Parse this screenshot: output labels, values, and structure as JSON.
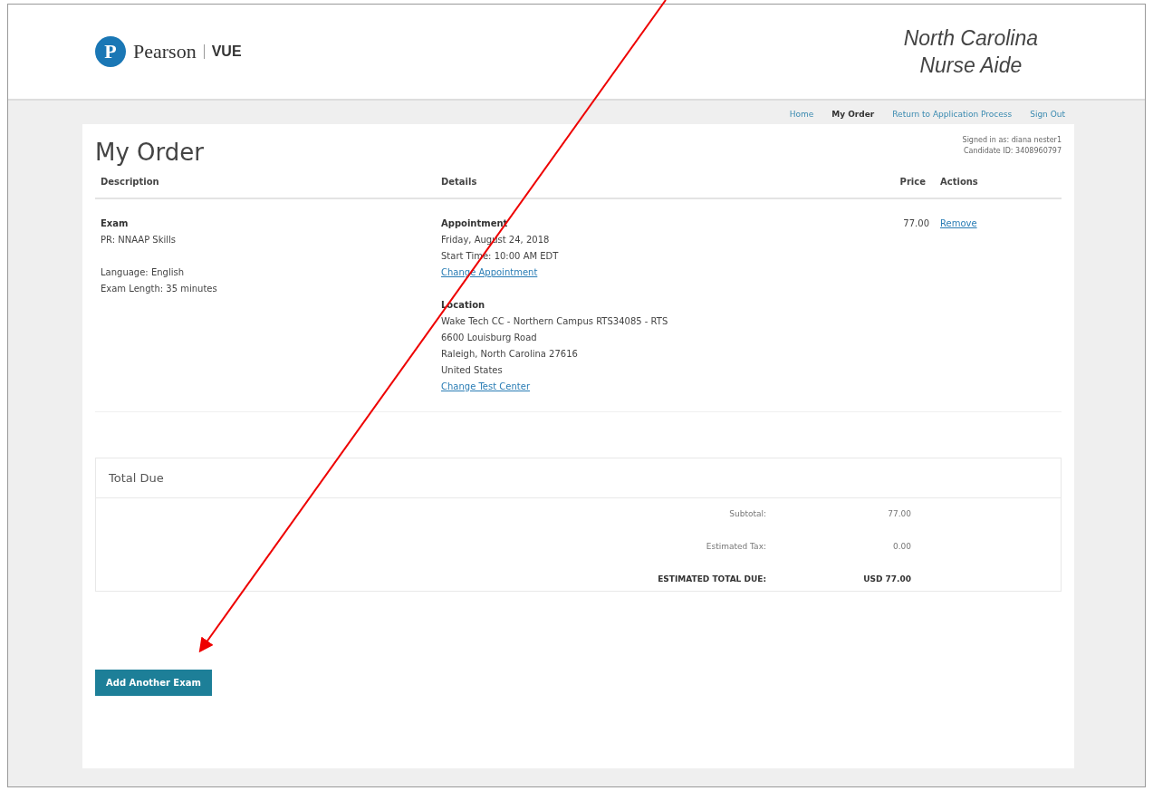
{
  "header": {
    "logo_letter": "P",
    "brand": "Pearson",
    "product": "VUE",
    "program_title": [
      "North Carolina",
      "Nurse Aide"
    ]
  },
  "nav": [
    {
      "label": "Home",
      "selected": false
    },
    {
      "label": "My Order",
      "selected": true
    },
    {
      "label": "Return to Application Process",
      "selected": false
    },
    {
      "label": "Sign Out",
      "selected": false
    }
  ],
  "page_title": "My Order",
  "account": [
    "Signed in as: diana nester1",
    "Candidate ID: 3408960797"
  ],
  "table": {
    "columns": [
      "Description",
      "Details",
      "Price",
      "Actions"
    ],
    "rows": [
      {
        "item_type": "Exam",
        "exam_name": "PR: NNAAP Skills",
        "language": "Language: English",
        "length": "Exam Length: 35 minutes",
        "details": [
          {
            "heading": "Appointment",
            "lines": [
              "Friday, August 24, 2018",
              "Start Time: 10:00 AM EDT"
            ],
            "link": "Change Appointment"
          },
          {
            "heading": "Location",
            "lines": [
              "Wake Tech CC - Northern Campus RTS34085 - RTS",
              "6600 Louisburg Road",
              "Raleigh, North Carolina 27616",
              "United States"
            ],
            "link": "Change Test Center"
          }
        ],
        "price": "77.00",
        "action": "Remove"
      }
    ]
  },
  "total_due": {
    "title": "Total Due",
    "lines": [
      {
        "label": "Subtotal:",
        "value": "77.00",
        "kind": "plain"
      },
      {
        "label": "Estimated Tax:",
        "value": "0.00",
        "kind": "plain"
      },
      {
        "label": "ESTIMATED TOTAL DUE:",
        "value": "USD 77.00",
        "kind": "total"
      }
    ]
  },
  "add_button": "Add Another Exam"
}
